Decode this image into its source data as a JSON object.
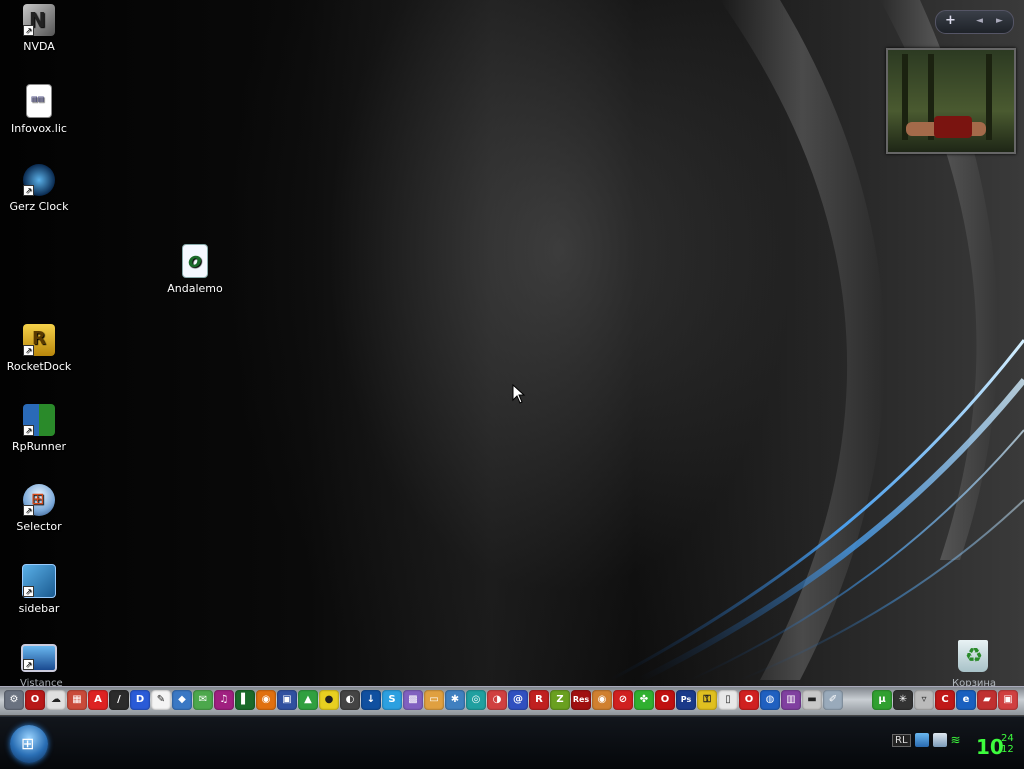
{
  "desktop_icons": [
    {
      "label": "NVDA",
      "icon": "nvda-icon",
      "shortcut": true
    },
    {
      "label": "Infovox.lic",
      "icon": "license-file-icon",
      "shortcut": false
    },
    {
      "label": "Gerz Clock",
      "icon": "clock-icon",
      "shortcut": true
    },
    {
      "label": "Andalemo",
      "icon": "opera-file-icon",
      "shortcut": false
    },
    {
      "label": "RocketDock",
      "icon": "rocketdock-icon",
      "shortcut": true
    },
    {
      "label": "RpRunner",
      "icon": "rprunner-icon",
      "shortcut": true
    },
    {
      "label": "Selector",
      "icon": "windows-logo-icon",
      "shortcut": true
    },
    {
      "label": "sidebar",
      "icon": "sidebar-icon",
      "shortcut": true
    },
    {
      "label": "",
      "icon": "monitor-icon",
      "shortcut": true
    }
  ],
  "gadget_bar": {
    "add_label": "+",
    "prev_label": "◄",
    "next_label": "►"
  },
  "recycle_bin": {
    "icon": "recycle-bin-icon"
  },
  "dock_labels": {
    "left": "Vistance",
    "right": "Корзина"
  },
  "dock_icons": [
    {
      "name": "system-icon",
      "color": "#6a7280",
      "glyph": "⚙"
    },
    {
      "name": "opera-icon",
      "color": "#b81818",
      "glyph": "O"
    },
    {
      "name": "sheep-icon",
      "color": "#e0e0e0",
      "glyph": "☁"
    },
    {
      "name": "arcade-icon",
      "color": "#c94a3a",
      "glyph": "▦"
    },
    {
      "name": "acrobat-icon",
      "color": "#d22",
      "glyph": "A"
    },
    {
      "name": "knife-icon",
      "color": "#2b2b2b",
      "glyph": "/"
    },
    {
      "name": "daemon-tools-icon",
      "color": "#2a5bd7",
      "glyph": "D"
    },
    {
      "name": "notepad-icon",
      "color": "#f4f4f4",
      "glyph": "✎"
    },
    {
      "name": "virtualbox-icon",
      "color": "#3a78c4",
      "glyph": "◆"
    },
    {
      "name": "messenger-icon",
      "color": "#4ca84c",
      "glyph": "✉"
    },
    {
      "name": "winamp-icon",
      "color": "#a02080",
      "glyph": "♫"
    },
    {
      "name": "book-icon",
      "color": "#1a6a2a",
      "glyph": "▌"
    },
    {
      "name": "firefox-icon",
      "color": "#e07010",
      "glyph": "◉"
    },
    {
      "name": "save-icon",
      "color": "#3050a0",
      "glyph": "▣"
    },
    {
      "name": "map-icon",
      "color": "#30a040",
      "glyph": "▲"
    },
    {
      "name": "cd-icon",
      "color": "#e8d020",
      "glyph": "●"
    },
    {
      "name": "cat-icon",
      "color": "#444",
      "glyph": "◐"
    },
    {
      "name": "download-icon",
      "color": "#1050a0",
      "glyph": "↓"
    },
    {
      "name": "skype-icon",
      "color": "#2ca0e0",
      "glyph": "S"
    },
    {
      "name": "image-viewer-icon",
      "color": "#8060c0",
      "glyph": "▩"
    },
    {
      "name": "folder-icon",
      "color": "#e0a040",
      "glyph": "▭"
    },
    {
      "name": "puzzle-icon",
      "color": "#4080c0",
      "glyph": "✱"
    },
    {
      "name": "sync-icon",
      "color": "#20a0a0",
      "glyph": "◎"
    },
    {
      "name": "media-player-icon",
      "color": "#d04040",
      "glyph": "◑"
    },
    {
      "name": "address-icon",
      "color": "#3050c0",
      "glyph": "@"
    },
    {
      "name": "font-icon",
      "color": "#c02020",
      "glyph": "R"
    },
    {
      "name": "zip-icon",
      "color": "#6aa020",
      "glyph": "Z"
    },
    {
      "name": "reshacker-icon",
      "color": "#a01010",
      "glyph": "Res"
    },
    {
      "name": "eye-icon",
      "color": "#d08030",
      "glyph": "◉"
    },
    {
      "name": "stop-icon",
      "color": "#d02020",
      "glyph": "⊘"
    },
    {
      "name": "clover-icon",
      "color": "#30b030",
      "glyph": "✤"
    },
    {
      "name": "opera-red-icon",
      "color": "#c01010",
      "glyph": "O"
    },
    {
      "name": "photoshop-icon",
      "color": "#1a3a8a",
      "glyph": "Ps"
    },
    {
      "name": "keys-icon",
      "color": "#e0c020",
      "glyph": "⚿"
    },
    {
      "name": "document-icon",
      "color": "#e8e8e8",
      "glyph": "▯"
    },
    {
      "name": "opera-alt-icon",
      "color": "#d02020",
      "glyph": "O"
    },
    {
      "name": "globe-icon",
      "color": "#2060c0",
      "glyph": "◍"
    },
    {
      "name": "books-icon",
      "color": "#8040a0",
      "glyph": "▥"
    },
    {
      "name": "scanner-icon",
      "color": "#c8c8c8",
      "glyph": "▬"
    },
    {
      "name": "pen-icon",
      "color": "#9ab",
      "glyph": "✐"
    }
  ],
  "dock_right_icons": [
    {
      "name": "utorrent-icon",
      "color": "#30a030",
      "glyph": "µ"
    },
    {
      "name": "spider-icon",
      "color": "#333",
      "glyph": "✳"
    },
    {
      "name": "trash-dock-icon",
      "color": "#bbb",
      "glyph": "▿"
    },
    {
      "name": "ccleaner-icon",
      "color": "#c01818",
      "glyph": "C"
    },
    {
      "name": "ie-icon",
      "color": "#1a60c0",
      "glyph": "e"
    },
    {
      "name": "car-icon",
      "color": "#c03030",
      "glyph": "▰"
    },
    {
      "name": "gift-icon",
      "color": "#d04040",
      "glyph": "▣"
    }
  ],
  "start_button": {
    "glyph": "⊞"
  },
  "tray": {
    "language": "RL"
  },
  "clock": {
    "hour": "10",
    "minute": "24",
    "second": "12"
  }
}
